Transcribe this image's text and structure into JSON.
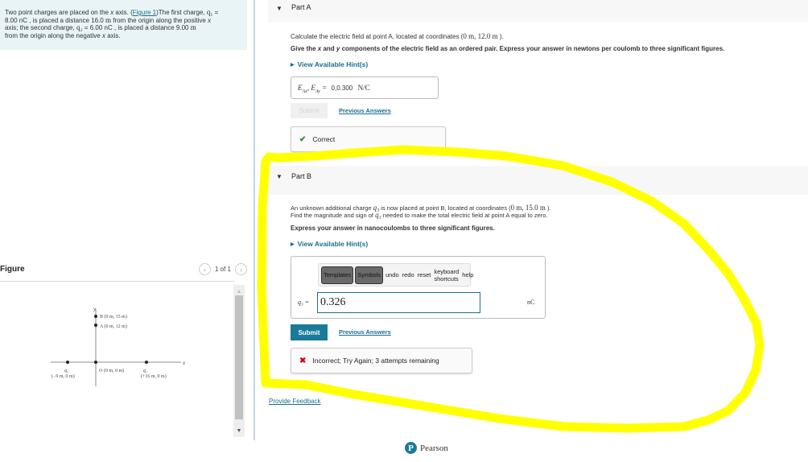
{
  "problem": {
    "intro": "Two point charges are placed on the ",
    "x_var": "x",
    "axis_word": " axis. (",
    "figure_link": "Figure 1",
    "after_link": ")The first charge, ",
    "q1_symbol": "q₁",
    "q1_eq": " = ",
    "q1_value": "8.00 nC",
    "q1_rest_a": " , is placed a distance 16.0 ",
    "unit_m": "m",
    "q1_rest_b": " from the origin along the positive ",
    "q1_rest_c": " axis; the second charge, ",
    "q2_symbol": "q₂",
    "q2_value": " = 6.00 nC",
    "q2_rest_a": " , is placed a distance 9.00 ",
    "q2_rest_b": " from the origin along the negative ",
    "q2_rest_c": " axis."
  },
  "figure": {
    "title": "Figure",
    "pager": "1 of 1",
    "prev_icon": "‹",
    "next_icon": "›",
    "labels": {
      "y_axis": "y",
      "x_axis": "x",
      "point_b": "B (0 m, 15 m)",
      "point_a": "A (0 m, 12 m)",
      "origin": "O (0 m, 0 m)",
      "q2": "q₂",
      "q2_coords": "(−9 m, 0 m)",
      "q1": "q₁",
      "q1_coords": "(+16 m, 0 m)"
    },
    "scroll_up_icon": "▲",
    "scroll_down_icon": "▼"
  },
  "part_a": {
    "title": "Part A",
    "question_prefix": "Calculate the electric field at point A, located at coordinates (",
    "coords": "0 m, 12.0 m",
    "question_suffix": " ).",
    "instruction_a": "Give the ",
    "instruction_x": "x",
    "instruction_b": " and ",
    "instruction_y": "y",
    "instruction_c": " components of the electric field as an ordered pair. Express your answer in newtons per coulomb to three significant figures.",
    "hint": "View Available Hint(s)",
    "answer_lhs": "E_Ax, E_Ay =",
    "answer_value": "0,0.300",
    "answer_unit": "N/C",
    "submit": "Submit",
    "previous_answers": "Previous Answers",
    "feedback": "Correct"
  },
  "part_b": {
    "title": "Part B",
    "line1_a": "An unknown additional charge ",
    "q3": "q₃",
    "line1_b": " is now placed at point B, located at coordinates (",
    "coords": "0 m, 15.0 m",
    "line1_c": " ).",
    "line2_a": "Find the magnitude and sign of ",
    "line2_b": " needed to make the total electric field at point A equal to zero.",
    "instruction": "Express your answer in nanocoulombs to three significant figures.",
    "hint": "View Available Hint(s)",
    "toolbar": {
      "templates": "Templates",
      "symbols": "Symbols",
      "undo": "undo",
      "redo": "redo",
      "reset": "reset",
      "shortcuts": "keyboard shortcuts",
      "help": "help"
    },
    "input_label": "q₃ =",
    "input_value": "0.326",
    "unit": "nC",
    "submit": "Submit",
    "previous_answers": "Previous Answers",
    "feedback": "Incorrect; Try Again; 3 attempts remaining"
  },
  "footer": {
    "provide_feedback": "Provide Feedback",
    "brand": "Pearson",
    "brand_logo": "P"
  },
  "colors": {
    "accent": "#1a7a99",
    "link": "#1a6e8e",
    "correct": "#2e8b3a",
    "incorrect": "#d0021b",
    "highlight": "#ffff00"
  }
}
